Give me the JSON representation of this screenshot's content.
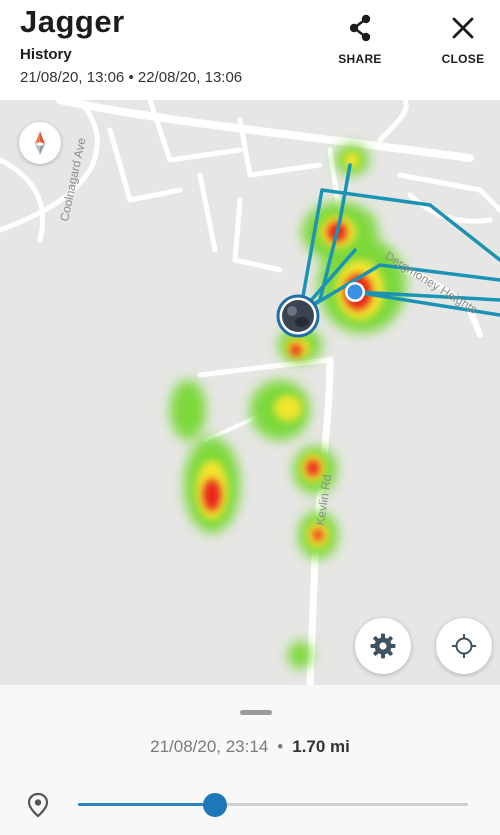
{
  "header": {
    "title": "Jagger",
    "subtitle": "History",
    "date_from": "21/08/20, 13:06",
    "date_separator": "•",
    "date_to": "22/08/20, 13:06",
    "share_label": "SHARE",
    "close_label": "CLOSE"
  },
  "map": {
    "streets": [
      "Coolnagard Ave",
      "Dergmoney Heights",
      "Kevlin Rd"
    ],
    "heat_colors": {
      "low": "#7bd83a",
      "mid": "#f2e52f",
      "high": "#e8231c"
    },
    "route_color": "#1a93b4",
    "current_dot_color": "#3a8ee6"
  },
  "bottom": {
    "timestamp": "21/08/20, 23:14",
    "separator": "•",
    "distance": "1.70 mi",
    "slider_progress": 0.35,
    "accent": "#1f76b8"
  }
}
